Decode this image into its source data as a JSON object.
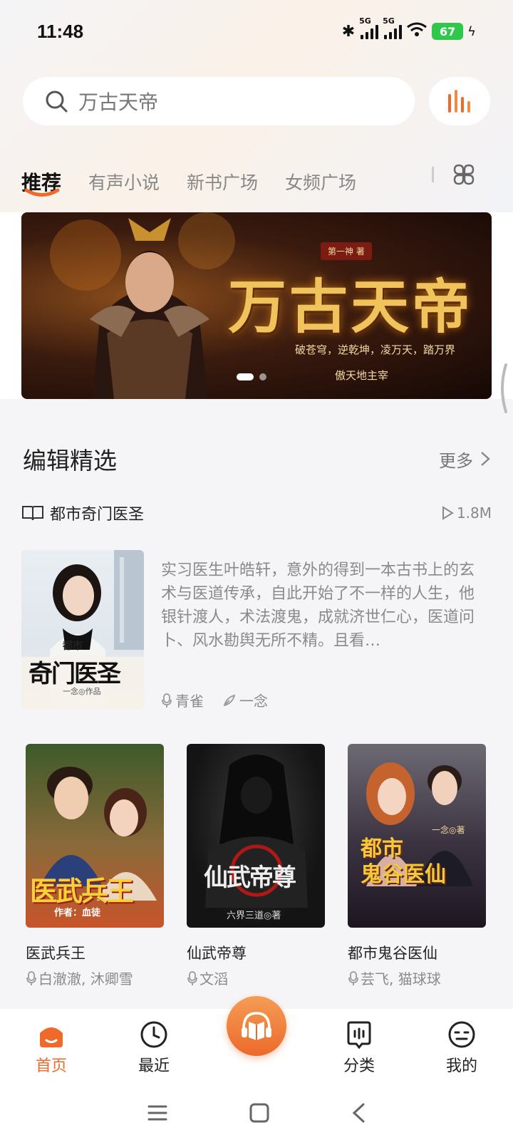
{
  "status_bar": {
    "time": "11:48",
    "network_1": "5G",
    "network_2": "5G",
    "battery": "67"
  },
  "search": {
    "text": "万古天帝"
  },
  "tabs": [
    {
      "label": "推荐",
      "active": true
    },
    {
      "label": "有声小说"
    },
    {
      "label": "新书广场"
    },
    {
      "label": "女频广场"
    }
  ],
  "banner": {
    "badge": "第一神 著",
    "title": "万古天帝",
    "line1": "破苍穹，逆乾坤，凌万天，踏万界",
    "line2": "傲天地主宰",
    "slides": 2,
    "current_slide": 1
  },
  "section": {
    "title": "编辑精选",
    "more": "更多"
  },
  "featured": {
    "title": "都市奇门医圣",
    "plays": "1.8M",
    "description": "实习医生叶皓轩，意外的得到一本古书上的玄术与医道传承，自此开始了不一样的人生，他银针渡人，术法渡鬼，成就济世仁心，医道问卜、风水勘舆无所不精。且看…",
    "narrator": "青雀",
    "author": "一念",
    "cover_text": {
      "top": "都市",
      "main": "奇门医圣",
      "author": "一念◎作品"
    }
  },
  "books": [
    {
      "title": "医武兵王",
      "narrators": "白澈澈, 沐卿雪",
      "cover_main": "医武兵王",
      "cover_author": "作者：血徒"
    },
    {
      "title": "仙武帝尊",
      "narrators": "文滔",
      "cover_main": "仙武帝尊",
      "cover_author": "六界三道◎著"
    },
    {
      "title": "都市鬼谷医仙",
      "narrators": "芸飞, 猫球球",
      "cover_main": "都市\n鬼谷医仙",
      "cover_author": "一念◎著"
    }
  ],
  "bottom_nav": [
    {
      "label": "首页",
      "icon": "home-icon",
      "active": true
    },
    {
      "label": "最近",
      "icon": "clock-icon"
    },
    {
      "label": "分类",
      "icon": "category-icon"
    },
    {
      "label": "我的",
      "icon": "profile-icon"
    }
  ],
  "colors": {
    "accent": "#ef6a2a",
    "accent_light": "#f59c55",
    "banner_gold": "#f1c35c"
  }
}
